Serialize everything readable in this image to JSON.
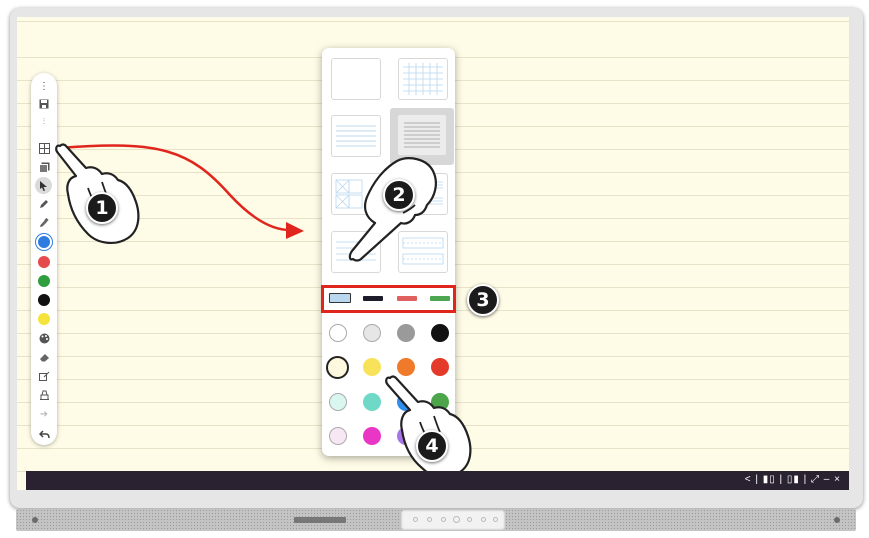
{
  "toolbar": {
    "icons": [
      "more-icon",
      "save-icon",
      "split-screen-icon",
      "background-template-icon",
      "pages-icon",
      "select-icon",
      "pen-icon",
      "highlighter-icon",
      "color-blue",
      "color-red",
      "color-green",
      "color-black",
      "color-yellow",
      "palette-icon",
      "eraser-icon",
      "shape-recognition-icon",
      "clear-icon",
      "redo-icon",
      "undo-icon"
    ],
    "pen_colors": [
      "#2f7ce0",
      "#e64a4a",
      "#2e9e3f",
      "#111111",
      "#f5e23a"
    ]
  },
  "background_panel": {
    "templates": [
      "blank",
      "grid",
      "lined-blue",
      "lined-gray",
      "cross-grid",
      "music-staff",
      "lined-small",
      "handwriting-grid"
    ],
    "selected_template": "lined-gray",
    "line_colors": [
      "#b9d7ef",
      "#1c1c2a",
      "#e06060",
      "#4ea650"
    ],
    "selected_line_color": "#b9d7ef",
    "background_colors": [
      "#ffffff",
      "#e6e6e6",
      "#9a9a9a",
      "#111111",
      "#fdf8de",
      "#f7e25a",
      "#ef7b2a",
      "#e43a2a",
      "#d9f6ef",
      "#6fd8c6",
      "#2f8ef0",
      "#4ca54a",
      "#f7e7f5",
      "#e936c5",
      "#a874e6",
      "#6a6a6a"
    ],
    "selected_background_color": "#fdf8de"
  },
  "callouts": {
    "step1": "1",
    "step2": "2",
    "step3": "3",
    "step4": "4"
  },
  "taskbar": {
    "controls": "< | ▮▯ | ▯▮ | ⤢  –  ×"
  },
  "colors": {
    "callout": "#e0251c",
    "screen_bg": "#fefbe6",
    "taskbar_bg": "#2a2230"
  }
}
